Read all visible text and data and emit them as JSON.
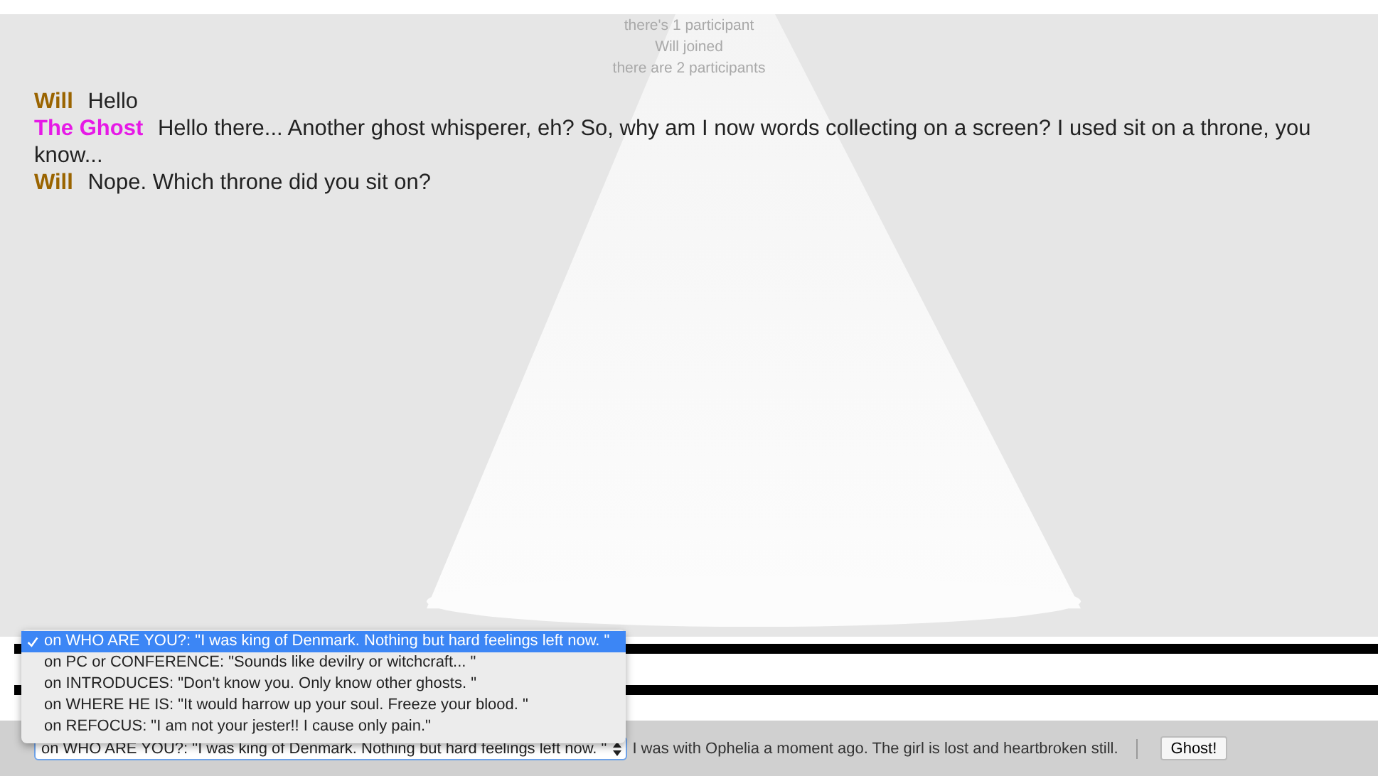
{
  "notices": [
    "there's 1 participant",
    "Will joined",
    "there are 2 participants"
  ],
  "messages": [
    {
      "sender": "Will",
      "color": "#9a6400",
      "text": "Hello"
    },
    {
      "sender": "The Ghost",
      "color": "#e619e6",
      "text": "Hello there... Another ghost whisperer, eh? So, why am I now words collecting on a screen? I used sit on a throne, you know..."
    },
    {
      "sender": "Will",
      "color": "#9a6400",
      "text": "Nope. Which throne did you sit on?"
    }
  ],
  "dropdown_menu": {
    "options": [
      {
        "label": "on WHO ARE YOU?: \"I was king of Denmark. Nothing but hard feelings left now. \"",
        "selected": true
      },
      {
        "label": "on PC or CONFERENCE: \"Sounds like devilry or witchcraft... \"",
        "selected": false
      },
      {
        "label": "on INTRODUCES: \"Don't know you. Only know other ghosts. \"",
        "selected": false
      },
      {
        "label": "on WHERE HE IS: \"It would harrow up your soul. Freeze your blood. \"",
        "selected": false
      },
      {
        "label": "on REFOCUS: \"I am not your jester!! I cause only pain.\"",
        "selected": false
      }
    ]
  },
  "toolbar": {
    "select_value": "on WHO ARE YOU?: \"I was king of Denmark. Nothing but hard feelings left now. \"",
    "reply_text": "I was with Ophelia a moment ago. The girl is lost and heartbroken still.",
    "button": "Ghost!"
  }
}
